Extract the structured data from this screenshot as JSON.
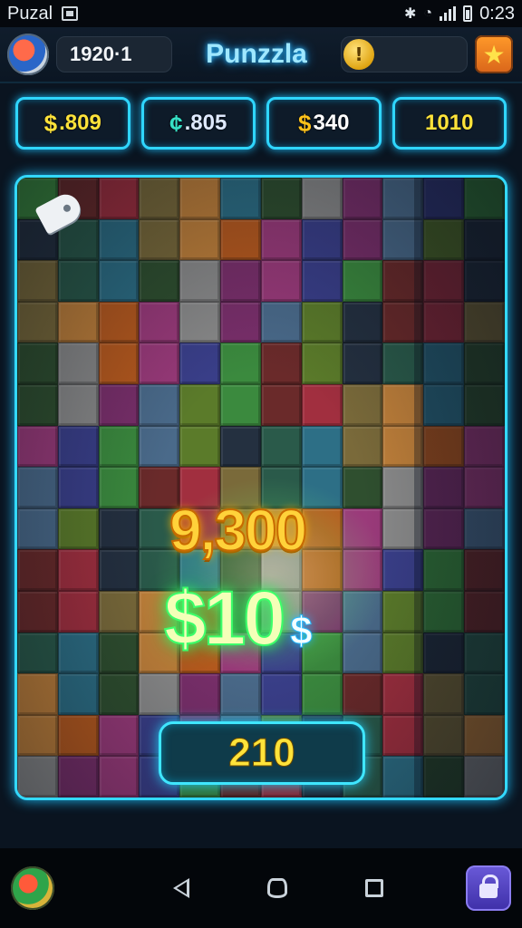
{
  "status_bar": {
    "app_name": "Puzal",
    "time": "0:23"
  },
  "header": {
    "score": "1920·1",
    "title": "Punzzla",
    "coin_symbol": "!"
  },
  "stats": [
    {
      "symbol": "$",
      "value": ".809"
    },
    {
      "symbol": "¢",
      "value": ".805"
    },
    {
      "symbol": "$",
      "value": "340"
    },
    {
      "symbol": "",
      "value": "1010"
    }
  ],
  "board": {
    "score_popup": "9,300",
    "prize_value": "$10",
    "prize_symbol": "$",
    "bottom_counter": "210",
    "piece_colors": [
      "#3b8a3e",
      "#7a2f6b",
      "#b85a1e",
      "#2d6f86",
      "#a12f3f",
      "#5b7b2a",
      "#3a3f8a",
      "#8a8a8a",
      "#c0803a",
      "#2a5a4a",
      "#6a2a2a",
      "#4a6a8a",
      "#9a3a7a",
      "#2f4f2f",
      "#7a6a3a",
      "#243040"
    ]
  },
  "colors": {
    "accent_neon": "#33d9ff",
    "gold": "#ffd23a",
    "green_glow": "#42ff6a"
  }
}
